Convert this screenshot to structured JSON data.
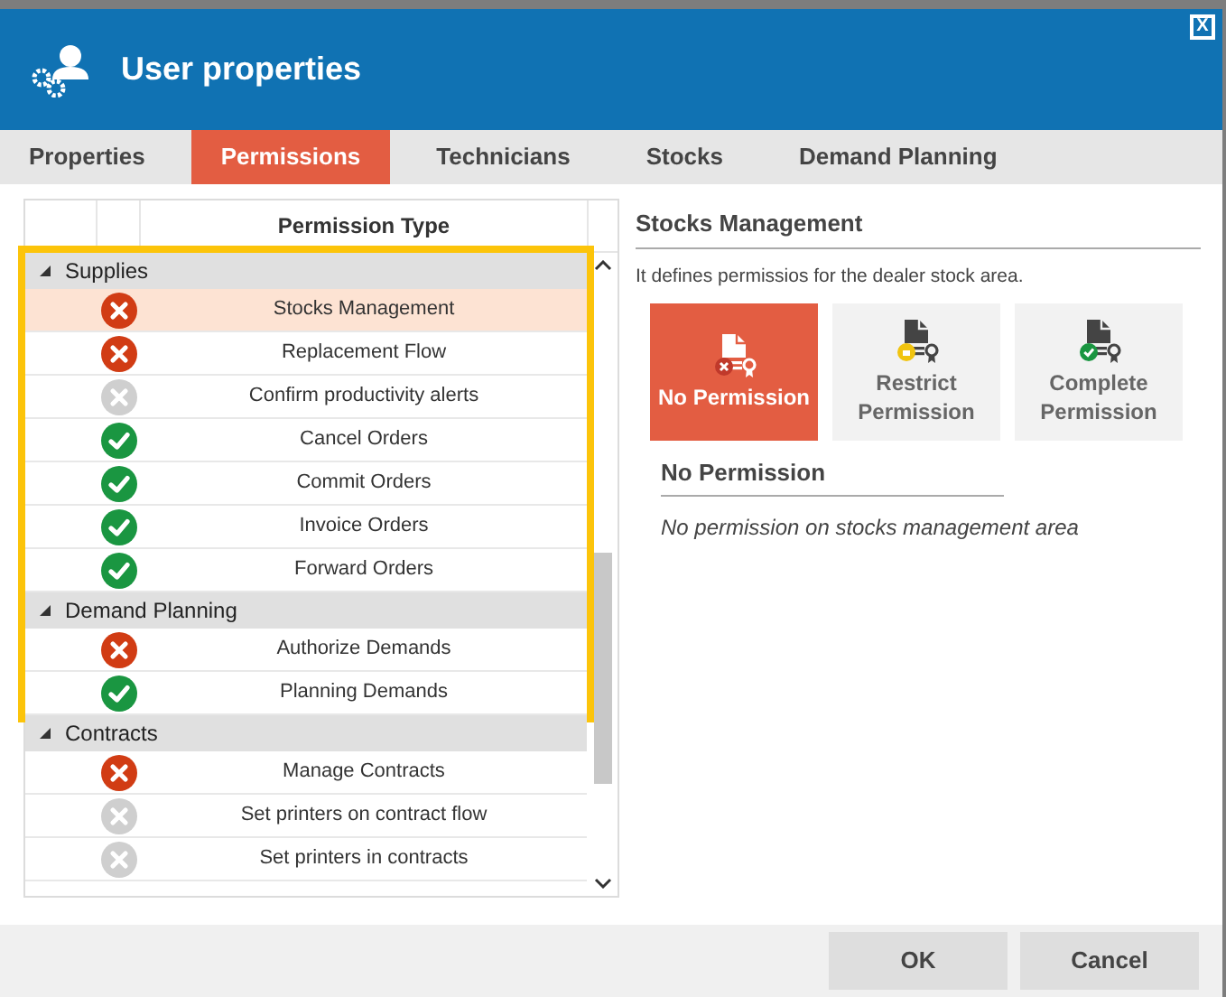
{
  "window": {
    "title": "User properties",
    "close": "X"
  },
  "tabs": [
    {
      "label": "Properties",
      "selected": false
    },
    {
      "label": "Permissions",
      "selected": true
    },
    {
      "label": "Technicians",
      "selected": false
    },
    {
      "label": "Stocks",
      "selected": false
    },
    {
      "label": "Demand Planning",
      "selected": false
    }
  ],
  "permission_list": {
    "column_header": "Permission Type",
    "groups": [
      {
        "name": "Supplies",
        "expanded": true,
        "highlighted": true,
        "items": [
          {
            "label": "Stocks Management",
            "kind": "denied",
            "selected": true
          },
          {
            "label": "Replacement Flow",
            "kind": "denied",
            "selected": false
          },
          {
            "label": "Confirm productivity alerts",
            "kind": "unset",
            "selected": false
          },
          {
            "label": "Cancel Orders",
            "kind": "granted",
            "selected": false
          },
          {
            "label": "Commit Orders",
            "kind": "granted",
            "selected": false
          },
          {
            "label": "Invoice Orders",
            "kind": "granted",
            "selected": false
          },
          {
            "label": "Forward Orders",
            "kind": "granted",
            "selected": false
          }
        ]
      },
      {
        "name": "Demand Planning",
        "expanded": true,
        "highlighted": true,
        "items": [
          {
            "label": "Authorize Demands",
            "kind": "denied",
            "selected": false
          },
          {
            "label": "Planning Demands",
            "kind": "granted",
            "selected": false
          }
        ]
      },
      {
        "name": "Contracts",
        "expanded": true,
        "highlighted": false,
        "items": [
          {
            "label": "Manage Contracts",
            "kind": "denied",
            "selected": false
          },
          {
            "label": "Set printers on contract flow",
            "kind": "unset",
            "selected": false
          },
          {
            "label": "Set printers in contracts",
            "kind": "unset",
            "selected": false
          }
        ]
      }
    ]
  },
  "detail": {
    "title": "Stocks Management",
    "description": "It defines permissios for the dealer stock area.",
    "options": [
      {
        "kind": "none",
        "label": "No Permission",
        "selected": true
      },
      {
        "kind": "restrict",
        "label": "Restrict Permission",
        "selected": false
      },
      {
        "kind": "complete",
        "label": "Complete Permission",
        "selected": false
      }
    ],
    "selected_title": "No Permission",
    "selected_description": "No permission on stocks management area"
  },
  "buttons": [
    "OK",
    "Cancel"
  ]
}
